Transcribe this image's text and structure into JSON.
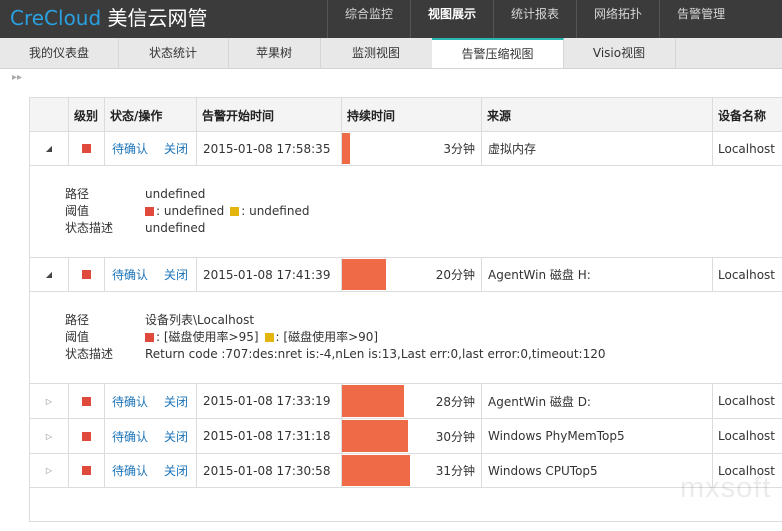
{
  "header": {
    "logo_brand": "CreCloud",
    "logo_cn": "美信云网管",
    "nav": [
      "综合监控",
      "视图展示",
      "统计报表",
      "网络拓扑",
      "告警管理"
    ],
    "nav_active": "视图展示"
  },
  "tabs": [
    "我的仪表盘",
    "状态统计",
    "苹果树",
    "监测视图",
    "告警压缩视图",
    "Visio视图"
  ],
  "tabs_active": "告警压缩视图",
  "table": {
    "columns": [
      "级别",
      "状态/操作",
      "告警开始时间",
      "持续时间",
      "来源",
      "设备名称"
    ],
    "rows": [
      {
        "expanded": true,
        "status": "待确认",
        "action": "关闭",
        "start_time": "2015-01-08 17:58:35",
        "duration": "3分钟",
        "duration_minutes": 3,
        "source": "虚拟内存",
        "device": "Localhost",
        "detail": {
          "path_label": "路径",
          "path": "undefined",
          "threshold_label": "阈值",
          "critical": ": undefined",
          "warning": ": undefined",
          "desc_label": "状态描述",
          "desc": "undefined"
        }
      },
      {
        "expanded": true,
        "status": "待确认",
        "action": "关闭",
        "start_time": "2015-01-08 17:41:39",
        "duration": "20分钟",
        "duration_minutes": 20,
        "source": "AgentWin 磁盘 H:",
        "device": "Localhost",
        "detail": {
          "path_label": "路径",
          "path": "设备列表\\Localhost",
          "threshold_label": "阈值",
          "critical": ": [磁盘使用率>95]",
          "warning": ": [磁盘使用率>90]",
          "desc_label": "状态描述",
          "desc": "Return code :707:des:nret is:-4,nLen is:13,Last err:0,last error:0,timeout:120"
        }
      },
      {
        "expanded": false,
        "status": "待确认",
        "action": "关闭",
        "start_time": "2015-01-08 17:33:19",
        "duration": "28分钟",
        "duration_minutes": 28,
        "source": "AgentWin 磁盘 D:",
        "device": "Localhost"
      },
      {
        "expanded": false,
        "status": "待确认",
        "action": "关闭",
        "start_time": "2015-01-08 17:31:18",
        "duration": "30分钟",
        "duration_minutes": 30,
        "source": "Windows PhyMemTop5",
        "device": "Localhost"
      },
      {
        "expanded": false,
        "status": "待确认",
        "action": "关闭",
        "start_time": "2015-01-08 17:30:58",
        "duration": "31分钟",
        "duration_minutes": 31,
        "source": "Windows CPUTop5",
        "device": "Localhost"
      }
    ]
  },
  "colors": {
    "severity": "#e04a3c",
    "warning": "#e2b50f",
    "duration_bar": "#ef6a47",
    "accent_tab": "#2bb6b0",
    "link": "#1c74b9"
  },
  "watermark": "mxsoft"
}
